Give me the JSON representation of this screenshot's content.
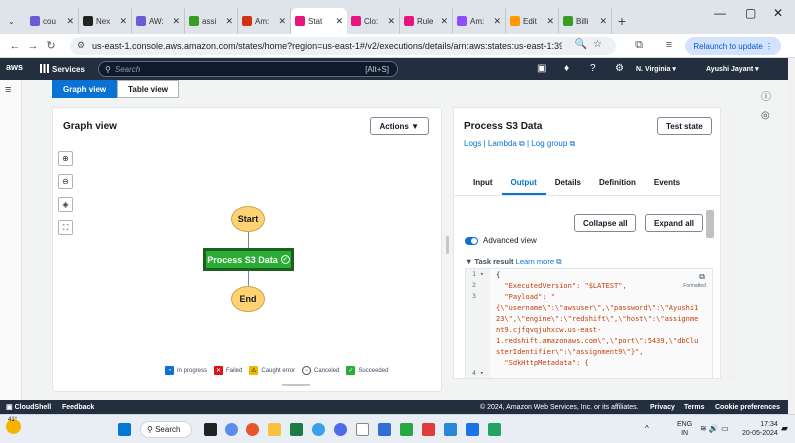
{
  "browser": {
    "tabs": [
      {
        "label": "cou",
        "color": "#6b5bd6"
      },
      {
        "label": "Nex",
        "color": "#222222"
      },
      {
        "label": "AW:",
        "color": "#6b5bd6"
      },
      {
        "label": "assi",
        "color": "#3a9d23"
      },
      {
        "label": "Am:",
        "color": "#d13212"
      },
      {
        "label": "Stat",
        "color": "#e7157b",
        "active": true
      },
      {
        "label": "Clo:",
        "color": "#e7157b"
      },
      {
        "label": "Rule",
        "color": "#e7157b"
      },
      {
        "label": "Am:",
        "color": "#8c4fff"
      },
      {
        "label": "Edit",
        "color": "#ff9900"
      },
      {
        "label": "Billi",
        "color": "#3a9d23"
      }
    ],
    "url": "us-east-1.console.aws.amazon.com/states/home?region=us-east-1#/v2/executions/details/arn:aws:states:us-east-1:39873...",
    "relaunch_label": "Relaunch to update"
  },
  "aws_header": {
    "logo": "aws",
    "services_label": "Services",
    "search_placeholder": "Search",
    "search_shortcut": "[Alt+S]",
    "region": "N. Virginia ▾",
    "user": "Ayushi Jayant ▾"
  },
  "view_tabs": [
    "Graph view",
    "Table view"
  ],
  "graph": {
    "title": "Graph view",
    "actions_label": "Actions ▼",
    "nodes": {
      "start": "Start",
      "task": "Process S3 Data",
      "end": "End"
    },
    "legend": [
      {
        "label": "In progress",
        "color": "#0972d3"
      },
      {
        "label": "Failed",
        "color": "#d91515"
      },
      {
        "label": "Caught error",
        "color": "#f2b705"
      },
      {
        "label": "Canceled",
        "color": "#ffffff"
      },
      {
        "label": "Succeeded",
        "color": "#29ad32"
      }
    ]
  },
  "details": {
    "title": "Process S3 Data",
    "test_state_label": "Test state",
    "links": {
      "logs": "Logs",
      "lambda": "Lambda",
      "log_group": "Log group"
    },
    "tabs": [
      "Input",
      "Output",
      "Details",
      "Definition",
      "Events"
    ],
    "active_tab": "Output",
    "collapse_label": "Collapse all",
    "expand_label": "Expand all",
    "advanced_view_label": "Advanced view",
    "task_result_label": "▼ Task result",
    "learn_more": "Learn more",
    "formatted_label": "Formatted",
    "code_gutter": [
      "1 ▾",
      "2",
      "3",
      "",
      "",
      "",
      "",
      "",
      "",
      "4 ▾"
    ],
    "code_lines": [
      "{",
      "  \"ExecutedVersion\": \"$LATEST\",",
      "  \"Payload\": \"",
      "{\\\"username\\\":\\\"awsuser\\\",\\\"password\\\":\\\"Ayushi1",
      "23\\\",\\\"engine\\\":\\\"redshift\\\",\\\"host\\\":\\\"assignme",
      "nt9.cjfqvqjuhxcw.us-east-",
      "1.redshift.amazonaws.com\\\",\\\"port\\\":5439,\\\"dbClu",
      "sterIdentifier\\\":\\\"assignment9\\\"}\",",
      "  \"SdkHttpMetadata\": {"
    ]
  },
  "footer": {
    "cloudshell": "CloudShell",
    "feedback": "Feedback",
    "copyright": "© 2024, Amazon Web Services, Inc. or its affiliates.",
    "privacy": "Privacy",
    "terms": "Terms",
    "cookies": "Cookie preferences"
  },
  "taskbar": {
    "weather": "41°",
    "search": "Search",
    "lang_top": "ENG",
    "lang_bottom": "IN",
    "time": "17:34",
    "date": "20-05-2024"
  }
}
